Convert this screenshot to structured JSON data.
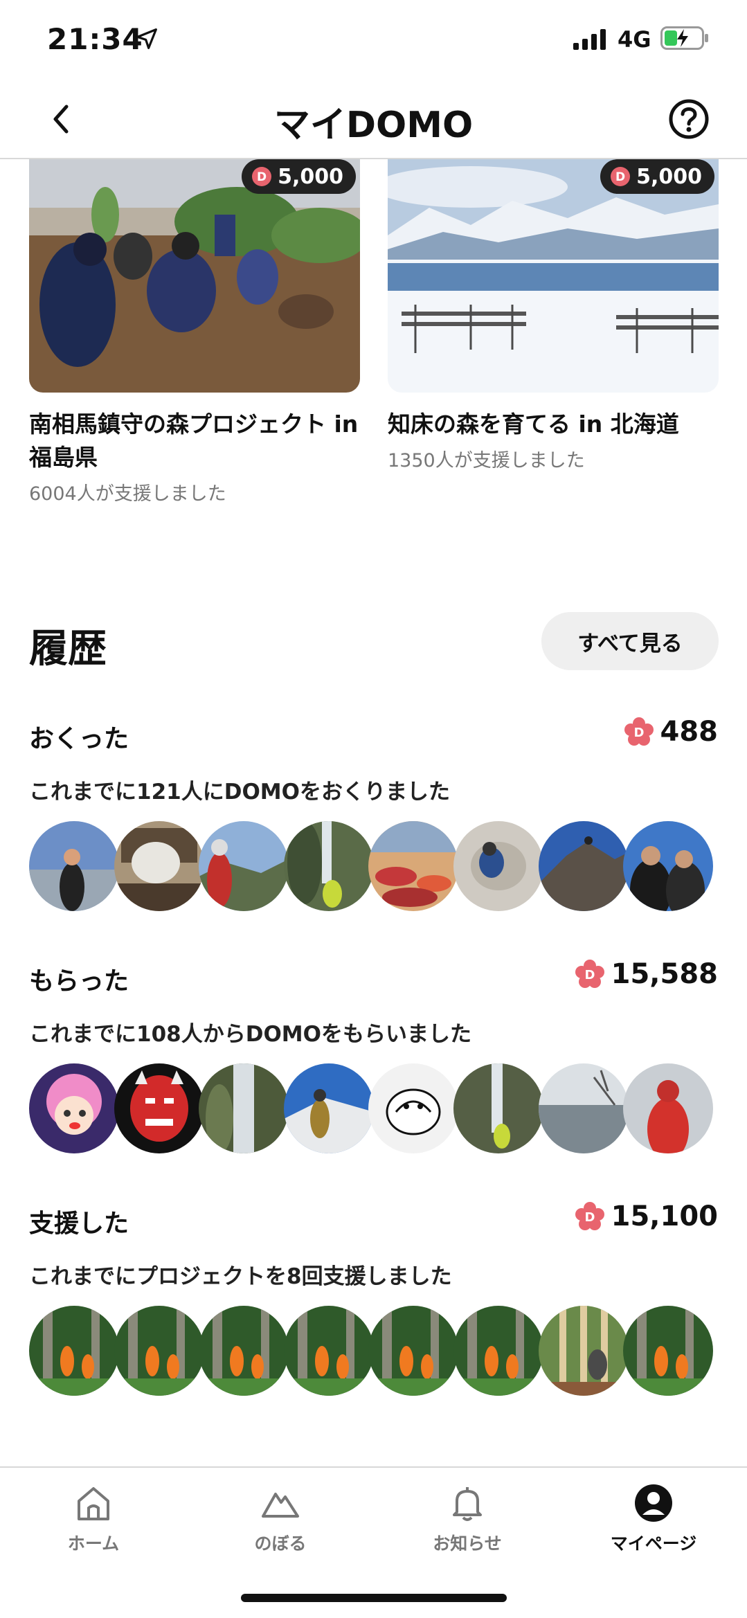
{
  "status_bar": {
    "time": "21:34",
    "network": "4G"
  },
  "header": {
    "title": "マイDOMO"
  },
  "projects": [
    {
      "price": "5,000",
      "title": "南相馬鎮守の森プロジェクト in 福島県",
      "supporters": "6004人が支援しました"
    },
    {
      "price": "5,000",
      "title": "知床の森を育てる in 北海道",
      "supporters": "1350人が支援しました"
    }
  ],
  "history": {
    "title": "履歴",
    "see_all": "すべて見る",
    "sent": {
      "label": "おくった",
      "count": "488",
      "description": "これまでに121人にDOMOをおくりました"
    },
    "received": {
      "label": "もらった",
      "count": "15,588",
      "description": "これまでに108人からDOMOをもらいました"
    },
    "supported": {
      "label": "支援した",
      "count": "15,100",
      "description": "これまでにプロジェクトを8回支援しました"
    }
  },
  "tabbar": {
    "items": [
      {
        "label": "ホーム",
        "icon": "home-icon"
      },
      {
        "label": "のぼる",
        "icon": "mountain-icon"
      },
      {
        "label": "お知らせ",
        "icon": "bell-icon"
      },
      {
        "label": "マイページ",
        "icon": "user-icon"
      }
    ],
    "active": "マイページ"
  },
  "colors": {
    "accent_red": "#e8646e",
    "badge_bg": "#222222",
    "muted": "#777777"
  }
}
